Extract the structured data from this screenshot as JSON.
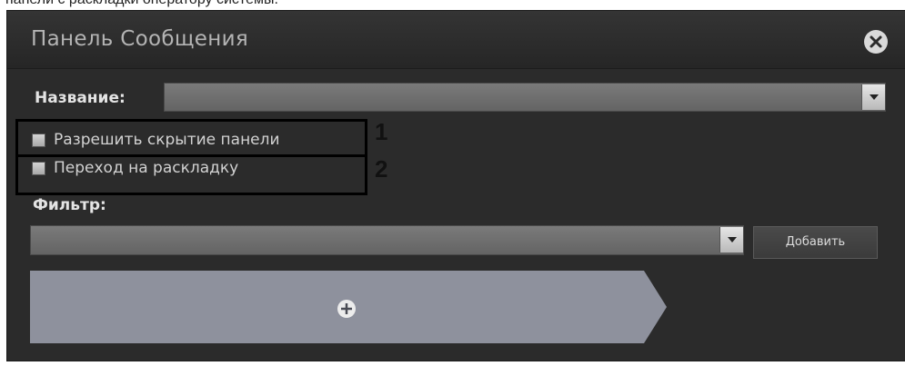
{
  "page": {
    "caption": "панели с раскладки оператору системы."
  },
  "dialog": {
    "title": "Панель Сообщения",
    "close_icon": "close-icon"
  },
  "name_field": {
    "label": "Название:",
    "value": ""
  },
  "options": [
    {
      "label": "Разрешить скрытие панели",
      "checked": false,
      "marker": "1"
    },
    {
      "label": "Переход на раскладку",
      "checked": false,
      "marker": "2"
    }
  ],
  "filter": {
    "label": "Фильтр:",
    "value": "",
    "add_button": "Добавить"
  },
  "add_panel": {
    "icon": "plus-icon"
  },
  "colors": {
    "dialog_bg": "#2b2b2b",
    "field_bg": "#6e6e6e",
    "tab_bg": "#8e919d",
    "highlight": "#000000"
  }
}
